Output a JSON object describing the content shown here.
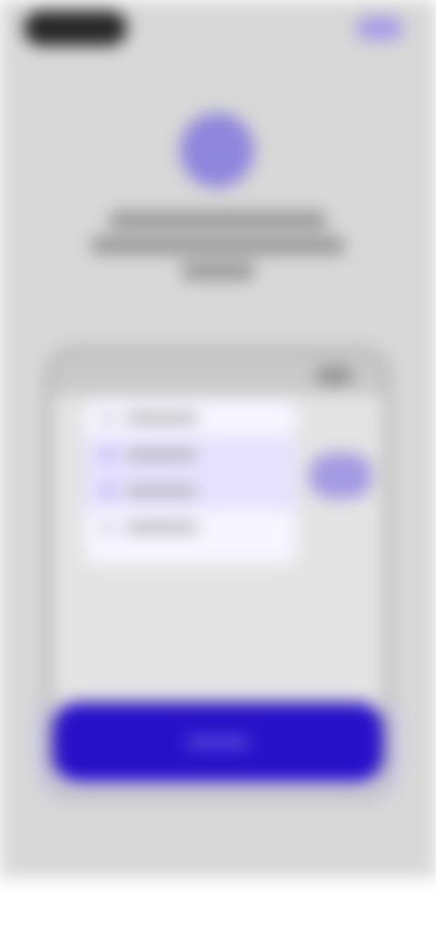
{
  "screen": {
    "state": "blurred-overlay"
  },
  "status": {
    "pill_color": "#262626"
  },
  "colors": {
    "backdrop": "#d8d8d8",
    "accent": "#8f86dd",
    "primary_button": "#2810c8",
    "menu_highlight": "#e7e2ff"
  },
  "header": {
    "close_icon": "close-icon"
  },
  "hero": {
    "avatar_icon": "avatar-icon"
  },
  "card": {
    "menu_item_count": 4,
    "highlighted_index": 1
  },
  "footer": {
    "primary_button_icon": "button"
  }
}
